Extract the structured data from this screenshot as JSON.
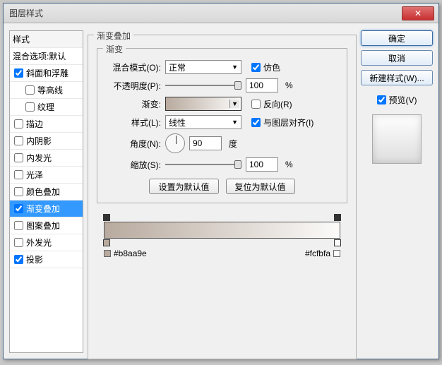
{
  "window": {
    "title": "图层样式"
  },
  "sidebar": {
    "header": "样式",
    "blend_opts": "混合选项:默认",
    "items": [
      {
        "label": "斜面和浮雕",
        "checked": true
      },
      {
        "label": "等高线",
        "checked": false,
        "indent": true
      },
      {
        "label": "纹理",
        "checked": false,
        "indent": true
      },
      {
        "label": "描边",
        "checked": false
      },
      {
        "label": "内阴影",
        "checked": false
      },
      {
        "label": "内发光",
        "checked": false
      },
      {
        "label": "光泽",
        "checked": false
      },
      {
        "label": "颜色叠加",
        "checked": false
      },
      {
        "label": "渐变叠加",
        "checked": true,
        "selected": true
      },
      {
        "label": "图案叠加",
        "checked": false
      },
      {
        "label": "外发光",
        "checked": false
      },
      {
        "label": "投影",
        "checked": true
      }
    ]
  },
  "panel": {
    "group_title": "渐变叠加",
    "inner_title": "渐变",
    "blend_mode_label": "混合模式(O):",
    "blend_mode_value": "正常",
    "dither_label": "仿色",
    "opacity_label": "不透明度(P):",
    "opacity_value": "100",
    "percent": "%",
    "gradient_label": "渐变:",
    "reverse_label": "反向(R)",
    "style_label": "样式(L):",
    "style_value": "线性",
    "align_label": "与图层对齐(I)",
    "angle_label": "角度(N):",
    "angle_value": "90",
    "angle_unit": "度",
    "scale_label": "缩放(S):",
    "scale_value": "100",
    "set_default": "设置为默认值",
    "reset_default": "复位为默认值"
  },
  "gradient": {
    "left_hex": "#b8aa9e",
    "right_hex": "#fcfbfa"
  },
  "right": {
    "ok": "确定",
    "cancel": "取消",
    "new_style": "新建样式(W)...",
    "preview": "预览(V)"
  }
}
